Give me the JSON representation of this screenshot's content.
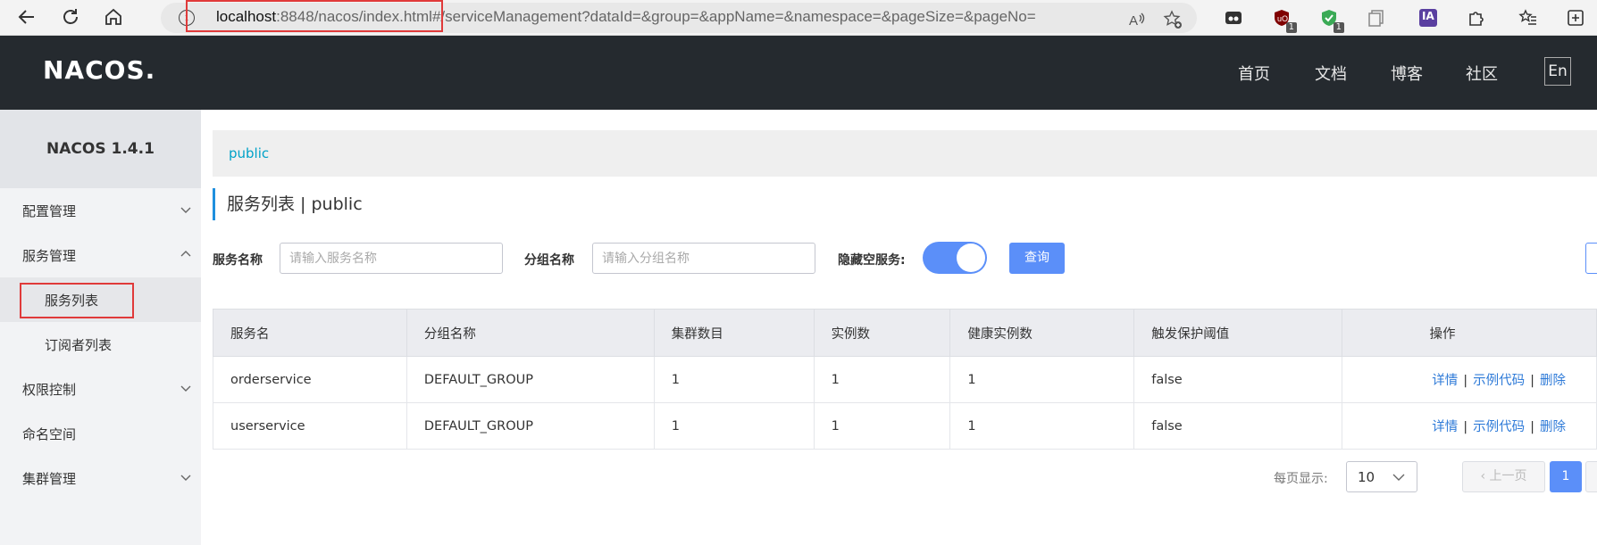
{
  "browser": {
    "url_host": "localhost",
    "url_rest": ":8848/nacos/index.html#/serviceManagement?dataId=&group=&appName=&namespace=&pageSize=&pageNo=",
    "ext_badges": [
      "1",
      "1"
    ],
    "ext_ia_label": "IA"
  },
  "header": {
    "logo": "NACOS.",
    "nav": [
      "首页",
      "文档",
      "博客",
      "社区"
    ],
    "lang": "En"
  },
  "sidebar": {
    "title": "NACOS 1.4.1",
    "items": [
      {
        "label": "配置管理"
      },
      {
        "label": "服务管理"
      },
      {
        "label": "服务列表"
      },
      {
        "label": "订阅者列表"
      },
      {
        "label": "权限控制"
      },
      {
        "label": "命名空间"
      },
      {
        "label": "集群管理"
      }
    ]
  },
  "namespace_bar": {
    "current": "public"
  },
  "page": {
    "title": "服务列表  |  public"
  },
  "filters": {
    "service_name_label": "服务名称",
    "service_name_placeholder": "请输入服务名称",
    "group_name_label": "分组名称",
    "group_name_placeholder": "请输入分组名称",
    "hide_empty_label": "隐藏空服务:",
    "hide_empty_on": true,
    "query_label": "查询"
  },
  "table": {
    "columns": [
      "服务名",
      "分组名称",
      "集群数目",
      "实例数",
      "健康实例数",
      "触发保护阈值",
      "操作"
    ],
    "rows": [
      [
        "orderservice",
        "DEFAULT_GROUP",
        "1",
        "1",
        "1",
        "false"
      ],
      [
        "userservice",
        "DEFAULT_GROUP",
        "1",
        "1",
        "1",
        "false"
      ]
    ],
    "actions": {
      "detail": "详情",
      "sample": "示例代码",
      "delete": "删除",
      "sep": "|"
    }
  },
  "pagination": {
    "per_page_label": "每页显示:",
    "page_size": "10",
    "prev_label": "上一页",
    "current_page": "1"
  },
  "colors": {
    "accent": "#5b8ff9",
    "header_bg": "#252a2f",
    "link": "#2f7bd8",
    "namespace_text": "#00a2c8",
    "highlight_box": "#e03a3a"
  }
}
